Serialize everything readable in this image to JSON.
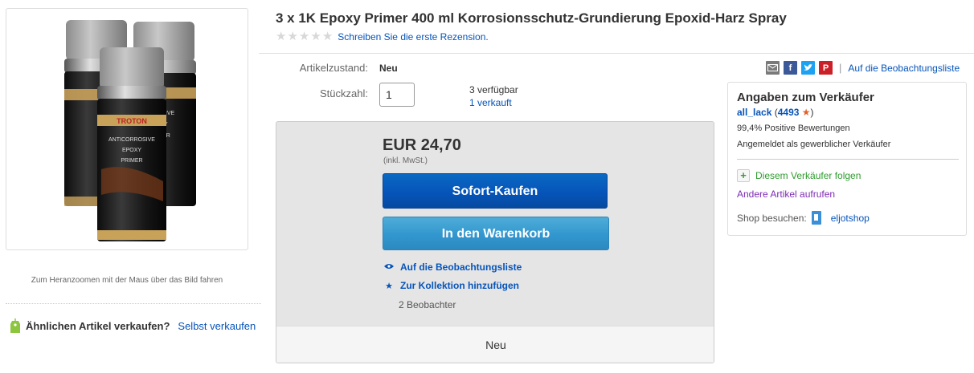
{
  "product": {
    "title": "3 x 1K Epoxy Primer 400 ml Korrosionsschutz-Grundierung Epoxid-Harz Spray",
    "review_link": "Schreiben Sie die erste Rezension.",
    "rating_stars": 0,
    "image_can_brand": "TROTON",
    "image_can_text": [
      "ANTICORROSIVE",
      "EPOXY",
      "PRIMER"
    ],
    "zoom_hint": "Zum Heranzoomen mit der Maus über das Bild fahren"
  },
  "sell_similar": {
    "question": "Ähnlichen Artikel verkaufen?",
    "link": "Selbst verkaufen",
    "icon": "tag-icon"
  },
  "details": {
    "condition_label": "Artikelzustand:",
    "condition_value": "Neu",
    "quantity_label": "Stückzahl:",
    "quantity_value": "1",
    "available": "3 verfügbar",
    "sold": "1 verkauft"
  },
  "buybox": {
    "price": "EUR 24,70",
    "vat_note": "(inkl. MwSt.)",
    "buy_now": "Sofort-Kaufen",
    "add_to_cart": "In den Warenkorb",
    "watch": "Auf die Beobachtungsliste",
    "collection": "Zur Kollektion hinzufügen",
    "watchers": "2 Beobachter",
    "footer": "Neu"
  },
  "share": {
    "watchlist_link": "Auf die Beobachtungsliste",
    "icons": [
      "email-icon",
      "facebook-icon",
      "twitter-icon",
      "pinterest-icon"
    ],
    "colors": {
      "email": "#7a7a7a",
      "facebook": "#3b5998",
      "twitter": "#1da1f2",
      "pinterest": "#cb2027"
    }
  },
  "seller": {
    "heading": "Angaben zum Verkäufer",
    "name": "all_lack",
    "feedback_open": "(",
    "feedback_score": "4493",
    "feedback_close": ")",
    "positive": "99,4% Positive Bewertungen",
    "registered": "Angemeldet als gewerblicher Verkäufer",
    "follow": "Diesem Verkäufer folgen",
    "other_items": "Andere Artikel aufrufen",
    "shop_label": "Shop besuchen:",
    "shop_name": "eljotshop"
  },
  "colors": {
    "link": "#0654ba",
    "buy_button": "#0654ba",
    "cart_button": "#3297cf",
    "follow_green": "#2f9b2f",
    "visited_purple": "#7e2bb5",
    "feedback_star": "#e0622d"
  }
}
